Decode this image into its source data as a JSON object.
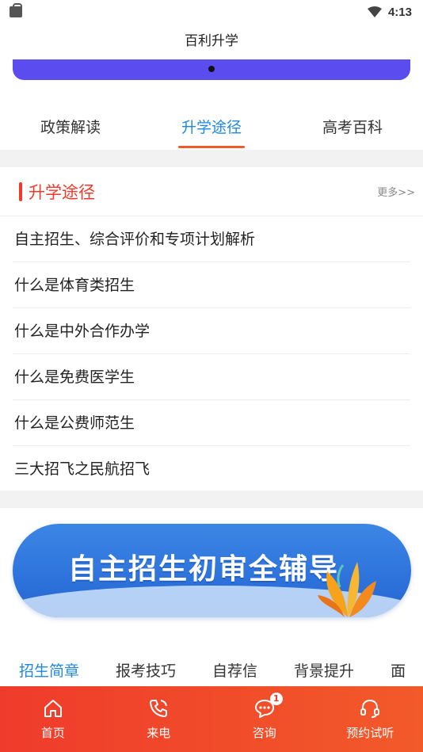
{
  "status": {
    "time": "4:13"
  },
  "app": {
    "title": "百利升学"
  },
  "tabs": [
    {
      "label": "政策解读"
    },
    {
      "label": "升学途径"
    },
    {
      "label": "高考百科"
    }
  ],
  "section": {
    "title": "升学途径",
    "more": "更多>>",
    "items": [
      "自主招生、综合评价和专项计划解析",
      "什么是体育类招生",
      "什么是中外合作办学",
      "什么是免费医学生",
      "什么是公费师范生",
      "三大招飞之民航招飞"
    ]
  },
  "ad": {
    "text": "自主招生初审全辅导"
  },
  "chips": [
    "招生简章",
    "报考技巧",
    "自荐信",
    "背景提升",
    "面"
  ],
  "bottom_nav": [
    {
      "label": "首页",
      "icon": "home-icon"
    },
    {
      "label": "来电",
      "icon": "phone-icon"
    },
    {
      "label": "咨询",
      "icon": "chat-icon",
      "badge": "1"
    },
    {
      "label": "预约试听",
      "icon": "headset-icon"
    }
  ],
  "colors": {
    "accent": "#1e88e5",
    "brand": "#ef3b2b",
    "banner": "#5b4cf0"
  }
}
